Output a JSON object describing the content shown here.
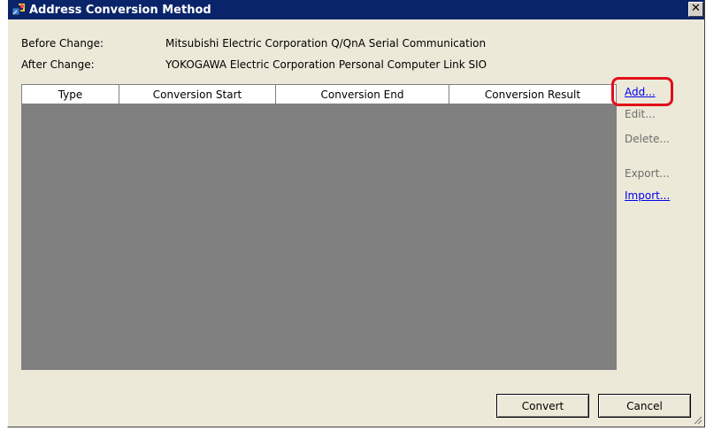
{
  "window": {
    "title": "Address Conversion Method",
    "close_glyph": "✕"
  },
  "info": {
    "before_label": "Before Change:",
    "before_value": "Mitsubishi Electric Corporation Q/QnA Serial Communication",
    "after_label": "After Change:",
    "after_value": "YOKOGAWA Electric Corporation Personal Computer Link SIO"
  },
  "table": {
    "columns": [
      "Type",
      "Conversion Start",
      "Conversion End",
      "Conversion Result"
    ],
    "rows": []
  },
  "actions": {
    "add": "Add...",
    "edit": "Edit...",
    "delete": "Delete...",
    "export": "Export...",
    "import": "Import..."
  },
  "buttons": {
    "convert": "Convert",
    "cancel": "Cancel"
  },
  "colors": {
    "title_bar": "#0a246a",
    "link": "#0000ee",
    "disabled": "#6d6d6d",
    "highlight": "#e0101a",
    "grid_bg": "#808080"
  }
}
